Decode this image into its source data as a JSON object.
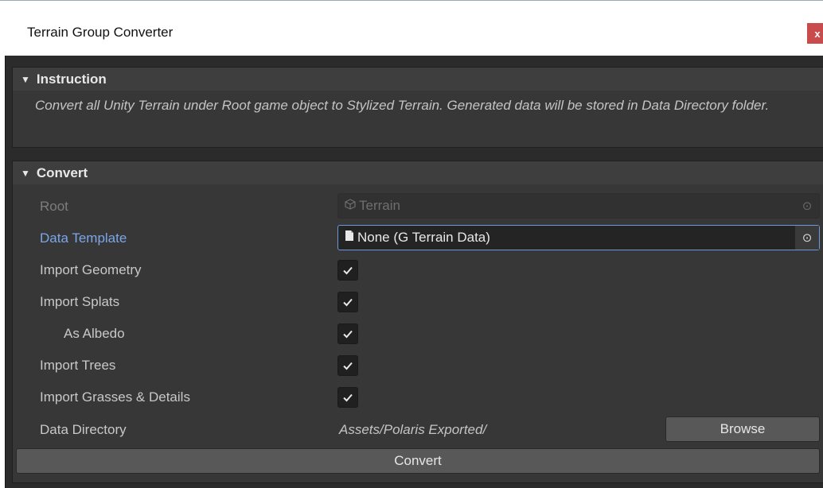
{
  "window": {
    "title": "Terrain Group Converter",
    "close_label": "x"
  },
  "instruction": {
    "header": "Instruction",
    "text": "Convert all Unity Terrain under Root game object to Stylized Terrain. Generated data will be stored in Data Directory folder."
  },
  "convert": {
    "header": "Convert",
    "root": {
      "label": "Root",
      "value": "Terrain"
    },
    "data_template": {
      "label": "Data Template",
      "value": "None (G Terrain Data)"
    },
    "import_geometry": {
      "label": "Import Geometry",
      "checked": true
    },
    "import_splats": {
      "label": "Import Splats",
      "checked": true
    },
    "as_albedo": {
      "label": "As Albedo",
      "checked": true
    },
    "import_trees": {
      "label": "Import Trees",
      "checked": true
    },
    "import_grasses": {
      "label": "Import Grasses & Details",
      "checked": true
    },
    "data_directory": {
      "label": "Data Directory",
      "value": "Assets/Polaris Exported/",
      "browse_label": "Browse"
    },
    "button_label": "Convert"
  }
}
